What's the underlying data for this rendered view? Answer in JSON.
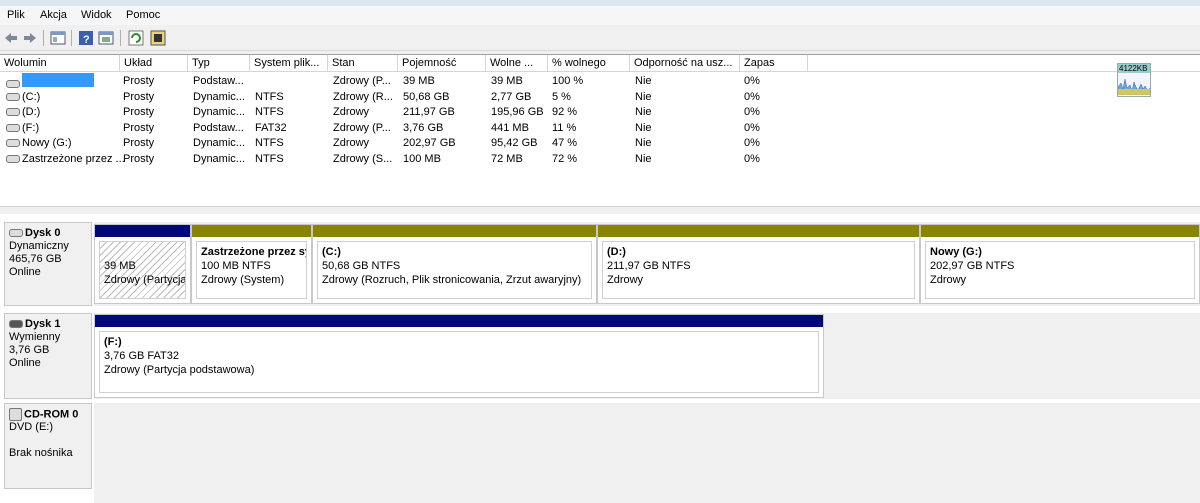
{
  "menu": [
    "Plik",
    "Akcja",
    "Widok",
    "Pomoc"
  ],
  "columns": [
    "Wolumin",
    "Układ",
    "Typ",
    "System plik...",
    "Stan",
    "Pojemność",
    "Wolne ...",
    "% wolnego",
    "Odporność na usz...",
    "Zapas"
  ],
  "rows": [
    {
      "name": "",
      "layout": "Prosty",
      "type": "Podstaw...",
      "fs": "",
      "status": "Zdrowy (P...",
      "capacity": "39 MB",
      "free": "39 MB",
      "pct": "100 %",
      "ft": "Nie",
      "overhead": "0%",
      "selected": true
    },
    {
      "name": "(C:)",
      "layout": "Prosty",
      "type": "Dynamic...",
      "fs": "NTFS",
      "status": "Zdrowy (R...",
      "capacity": "50,68 GB",
      "free": "2,77 GB",
      "pct": "5 %",
      "ft": "Nie",
      "overhead": "0%"
    },
    {
      "name": "(D:)",
      "layout": "Prosty",
      "type": "Dynamic...",
      "fs": "NTFS",
      "status": "Zdrowy",
      "capacity": "211,97 GB",
      "free": "195,96 GB",
      "pct": "92 %",
      "ft": "Nie",
      "overhead": "0%"
    },
    {
      "name": "(F:)",
      "layout": "Prosty",
      "type": "Podstaw...",
      "fs": "FAT32",
      "status": "Zdrowy (P...",
      "capacity": "3,76 GB",
      "free": "441 MB",
      "pct": "11 %",
      "ft": "Nie",
      "overhead": "0%"
    },
    {
      "name": "Nowy (G:)",
      "layout": "Prosty",
      "type": "Dynamic...",
      "fs": "NTFS",
      "status": "Zdrowy",
      "capacity": "202,97 GB",
      "free": "95,42 GB",
      "pct": "47 %",
      "ft": "Nie",
      "overhead": "0%"
    },
    {
      "name": "Zastrzeżone przez ...",
      "layout": "Prosty",
      "type": "Dynamic...",
      "fs": "NTFS",
      "status": "Zdrowy (S...",
      "capacity": "100 MB",
      "free": "72 MB",
      "pct": "72 %",
      "ft": "Nie",
      "overhead": "0%"
    }
  ],
  "graph_label": "4122KB",
  "disk0": {
    "title": "Dysk 0",
    "kind": "Dynamiczny",
    "size": "465,76 GB",
    "state": "Online",
    "parts": [
      {
        "title": "",
        "line1": "39 MB",
        "line2": "Zdrowy (Partycja"
      },
      {
        "title": "Zastrzeżone przez sy",
        "line1": "100 MB NTFS",
        "line2": "Zdrowy (System)"
      },
      {
        "title": "(C:)",
        "line1": "50,68 GB NTFS",
        "line2": "Zdrowy (Rozruch, Plik stronicowania, Zrzut awaryjny)"
      },
      {
        "title": "(D:)",
        "line1": "211,97 GB NTFS",
        "line2": "Zdrowy"
      },
      {
        "title": "Nowy  (G:)",
        "line1": "202,97 GB NTFS",
        "line2": "Zdrowy"
      }
    ]
  },
  "disk1": {
    "title": "Dysk 1",
    "kind": "Wymienny",
    "size": "3,76 GB",
    "state": "Online",
    "part": {
      "title": "(F:)",
      "line1": "3,76 GB FAT32",
      "line2": "Zdrowy (Partycja podstawowa)"
    }
  },
  "cdrom": {
    "title": "CD-ROM 0",
    "kind": "DVD (E:)",
    "state": "Brak nośnika"
  },
  "colors": {
    "primary_partition": "#00087a",
    "simple_volume": "#8a8500",
    "selection": "#3399ff"
  }
}
